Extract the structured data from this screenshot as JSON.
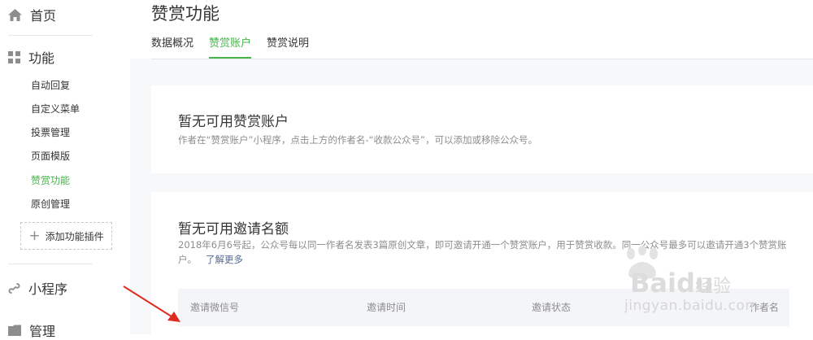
{
  "sidebar": {
    "home_label": "首页",
    "features_label": "功能",
    "feature_items": [
      {
        "label": "自动回复"
      },
      {
        "label": "自定义菜单"
      },
      {
        "label": "投票管理"
      },
      {
        "label": "页面模版"
      },
      {
        "label": "赞赏功能",
        "active": true
      },
      {
        "label": "原创管理"
      }
    ],
    "add_plugin_label": "添加功能插件",
    "miniprogram_label": "小程序",
    "manage_label": "管理"
  },
  "main": {
    "title": "赞赏功能",
    "tabs": [
      {
        "label": "数据概况"
      },
      {
        "label": "赞赏账户",
        "active": true
      },
      {
        "label": "赞赏说明"
      }
    ],
    "account_card": {
      "title": "暂无可用赞赏账户",
      "desc": "作者在“赞赏账户”小程序，点击上方的作者名-“收款公众号”，可以添加或移除公众号。"
    },
    "invite_card": {
      "title": "暂无可用邀请名额",
      "desc": "2018年6月6号起，公众号每以同一作者名发表3篇原创文章，即可邀请开通一个赞赏账户，用于赞赏收款。同一公众号最多可以邀请开通3个赞赏账户。",
      "learn_more": "了解更多",
      "table_headers": [
        "邀请微信号",
        "邀请时间",
        "邀请状态",
        "作者名"
      ]
    }
  },
  "watermark": {
    "brand": "Bai",
    "brand_suffix": "du",
    "brand_cn": "经验",
    "url": "jingyan.baidu.com"
  },
  "colors": {
    "accent_green": "#44b549",
    "link_blue": "#576b95",
    "annotation_red": "#e02b20"
  }
}
